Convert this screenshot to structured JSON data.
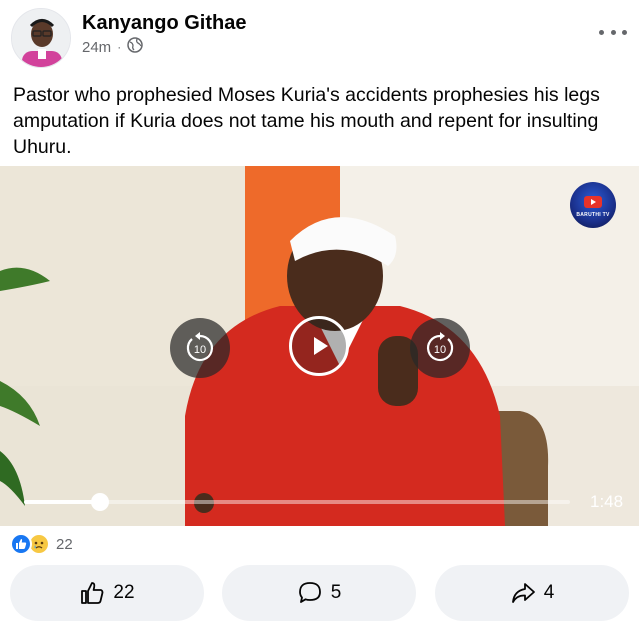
{
  "post": {
    "author": "Kanyango Githae",
    "time": "24m",
    "separator": "·",
    "privacy_icon": "globe-icon",
    "text": "Pastor who prophesied Moses Kuria's accidents prophesies his legs amputation if Kuria does not tame his mouth and repent for insulting Uhuru."
  },
  "video": {
    "duration": "1:48",
    "progress": 0.14,
    "rewind_label": "10",
    "forward_label": "10",
    "channel_logo_text": "BARUTHI TV"
  },
  "reactions": {
    "types": [
      "like-icon",
      "sad-icon"
    ],
    "count": "22"
  },
  "actions": {
    "like_count": "22",
    "comment_count": "5",
    "share_count": "4"
  },
  "colors": {
    "accent": "#1877f2",
    "button_bg": "#f0f2f5",
    "secondary_text": "#65676b"
  }
}
